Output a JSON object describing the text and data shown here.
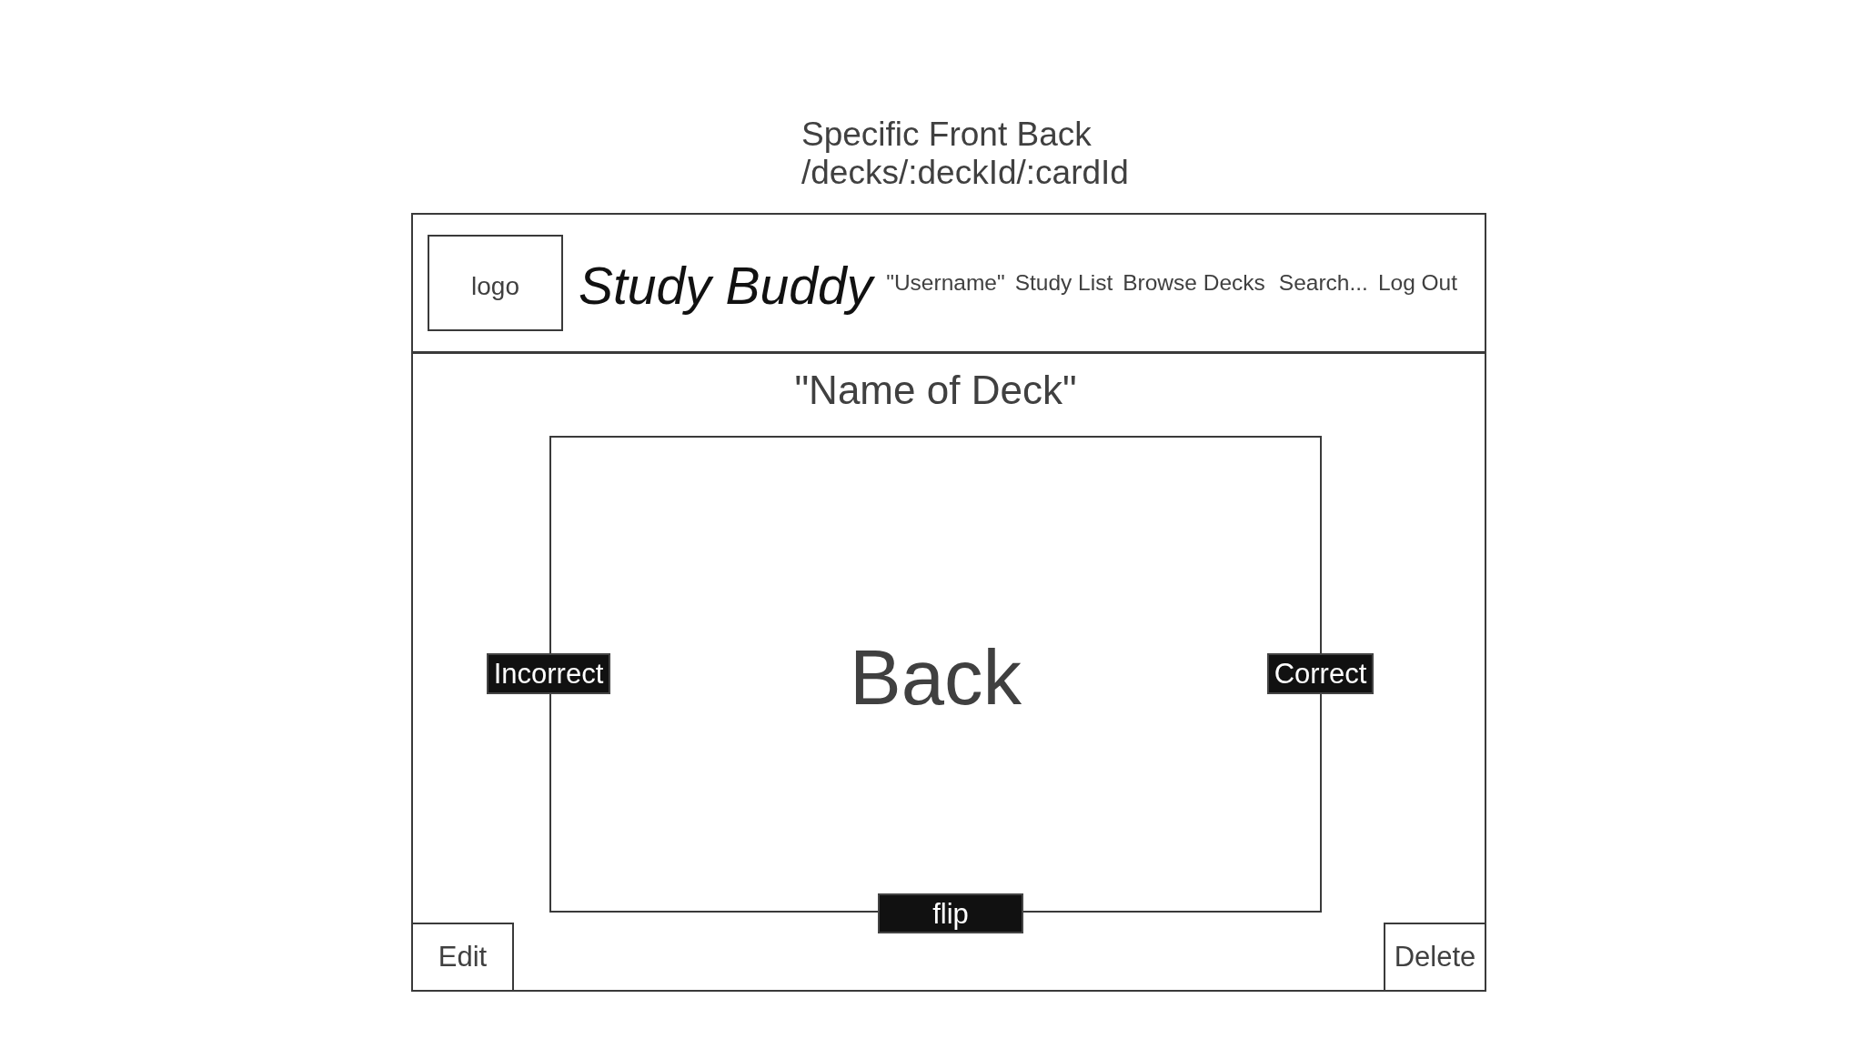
{
  "page_title": {
    "name": "Specific Front Back",
    "route": "/decks/:deckId/:cardId"
  },
  "header": {
    "logo": "logo",
    "app_name": "Study Buddy",
    "nav": [
      "\"Username\"",
      "Study List",
      "Browse Decks",
      "Search...",
      "Log Out"
    ]
  },
  "deck_title": "\"Name of Deck\"",
  "card": {
    "text": "Back",
    "incorrect_button": "Incorrect",
    "correct_button": "Correct",
    "flip_button": "flip"
  },
  "actions": {
    "edit_button": "Edit",
    "delete_button": "Delete"
  }
}
